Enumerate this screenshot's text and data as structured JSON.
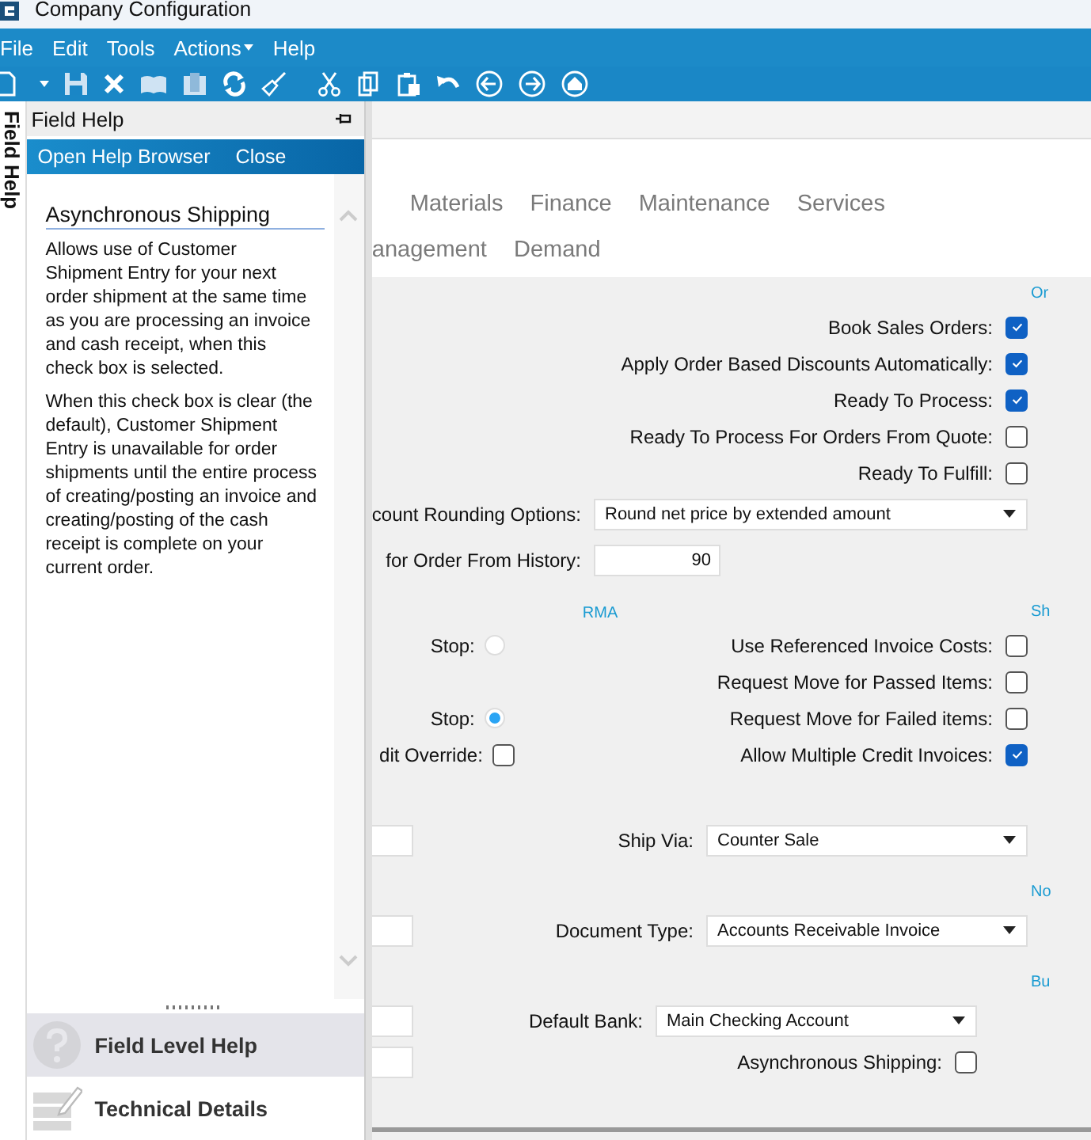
{
  "window": {
    "title": "Company Configuration"
  },
  "menu": [
    {
      "label": "File",
      "has_submenu": false
    },
    {
      "label": "Edit",
      "has_submenu": false
    },
    {
      "label": "Tools",
      "has_submenu": false
    },
    {
      "label": "Actions",
      "has_submenu": true
    },
    {
      "label": "Help",
      "has_submenu": false
    }
  ],
  "side_tab": {
    "label": "Field Help"
  },
  "help_panel": {
    "title": "Field Help",
    "actions": [
      "Open Help Browser",
      "Close"
    ],
    "topic": "Asynchronous Shipping",
    "paragraphs": [
      "Allows use of Customer Shipment Entry for your next order shipment at the same time as you are processing an invoice and cash receipt, when this check box is selected.",
      "When this check box is clear (the default), Customer Shipment Entry is unavailable for order shipments until the entire process of creating/posting an invoice and creating/posting of the cash receipt is complete on your current order."
    ],
    "nav": [
      {
        "kind": "help",
        "label": "Field Level Help",
        "selected": true
      },
      {
        "kind": "details",
        "label": "Technical Details",
        "selected": false
      }
    ]
  },
  "tab_rows": [
    {
      "tabs": [
        {
          "label": "Materials"
        },
        {
          "label": "Finance"
        },
        {
          "label": "Maintenance"
        },
        {
          "label": "Services"
        }
      ]
    },
    {
      "tabs": [
        {
          "label": "anagement"
        },
        {
          "label": "Demand"
        }
      ]
    }
  ],
  "form": {
    "groups": [
      {
        "side_label": "Or",
        "rows": [
          {
            "right": {
              "kind": "checkbox",
              "label": "Book Sales Orders:",
              "checked": true
            }
          },
          {
            "right": {
              "kind": "checkbox",
              "label": "Apply Order Based Discounts Automatically:",
              "checked": true
            }
          },
          {
            "right": {
              "kind": "checkbox",
              "label": "Ready To Process:",
              "checked": true
            }
          },
          {
            "right": {
              "kind": "checkbox",
              "label": "Ready To Process For Orders From Quote:",
              "checked": false
            }
          },
          {
            "right": {
              "kind": "checkbox",
              "label": "Ready To Fulfill:",
              "checked": false
            }
          },
          {
            "right": {
              "kind": "dropdown",
              "label": "count Rounding Options:",
              "value": "Round net price by extended amount"
            }
          },
          {
            "right": {
              "kind": "number",
              "label": "for Order From History:",
              "value": "90"
            }
          }
        ]
      },
      {
        "mid_label": "RMA",
        "side_label": "Sh",
        "rows": [
          {
            "left": {
              "kind": "radio",
              "label": "Stop:",
              "selected": false
            },
            "right": {
              "kind": "checkbox",
              "label": "Use Referenced Invoice Costs:",
              "checked": false
            }
          },
          {
            "right": {
              "kind": "checkbox",
              "label": "Request Move for Passed Items:",
              "checked": false
            }
          },
          {
            "left": {
              "kind": "radio",
              "label": "Stop:",
              "selected": true
            },
            "right": {
              "kind": "checkbox",
              "label": "Request Move for Failed items:",
              "checked": false
            }
          },
          {
            "left": {
              "kind": "checkbox",
              "label": "dit Override:",
              "checked": false
            },
            "right": {
              "kind": "checkbox",
              "label": "Allow Multiple Credit Invoices:",
              "checked": true
            }
          }
        ]
      },
      {
        "rows": [
          {
            "left": {
              "kind": "input"
            },
            "right": {
              "kind": "dropdown",
              "label": "Ship Via:",
              "value": "Counter Sale"
            }
          }
        ]
      },
      {
        "side_label": "No",
        "rows": [
          {
            "left": {
              "kind": "input"
            },
            "right": {
              "kind": "dropdown",
              "label": "Document Type:",
              "value": "Accounts Receivable Invoice"
            }
          }
        ]
      },
      {
        "side_label": "Bu",
        "rows": [
          {
            "left": {
              "kind": "input"
            },
            "right": {
              "kind": "dropdown",
              "label": "Default Bank:",
              "value": "Main Checking Account"
            }
          },
          {
            "left": {
              "kind": "input"
            },
            "right": {
              "kind": "checkbox",
              "label": "Asynchronous Shipping:",
              "checked": false
            }
          }
        ]
      }
    ]
  }
}
